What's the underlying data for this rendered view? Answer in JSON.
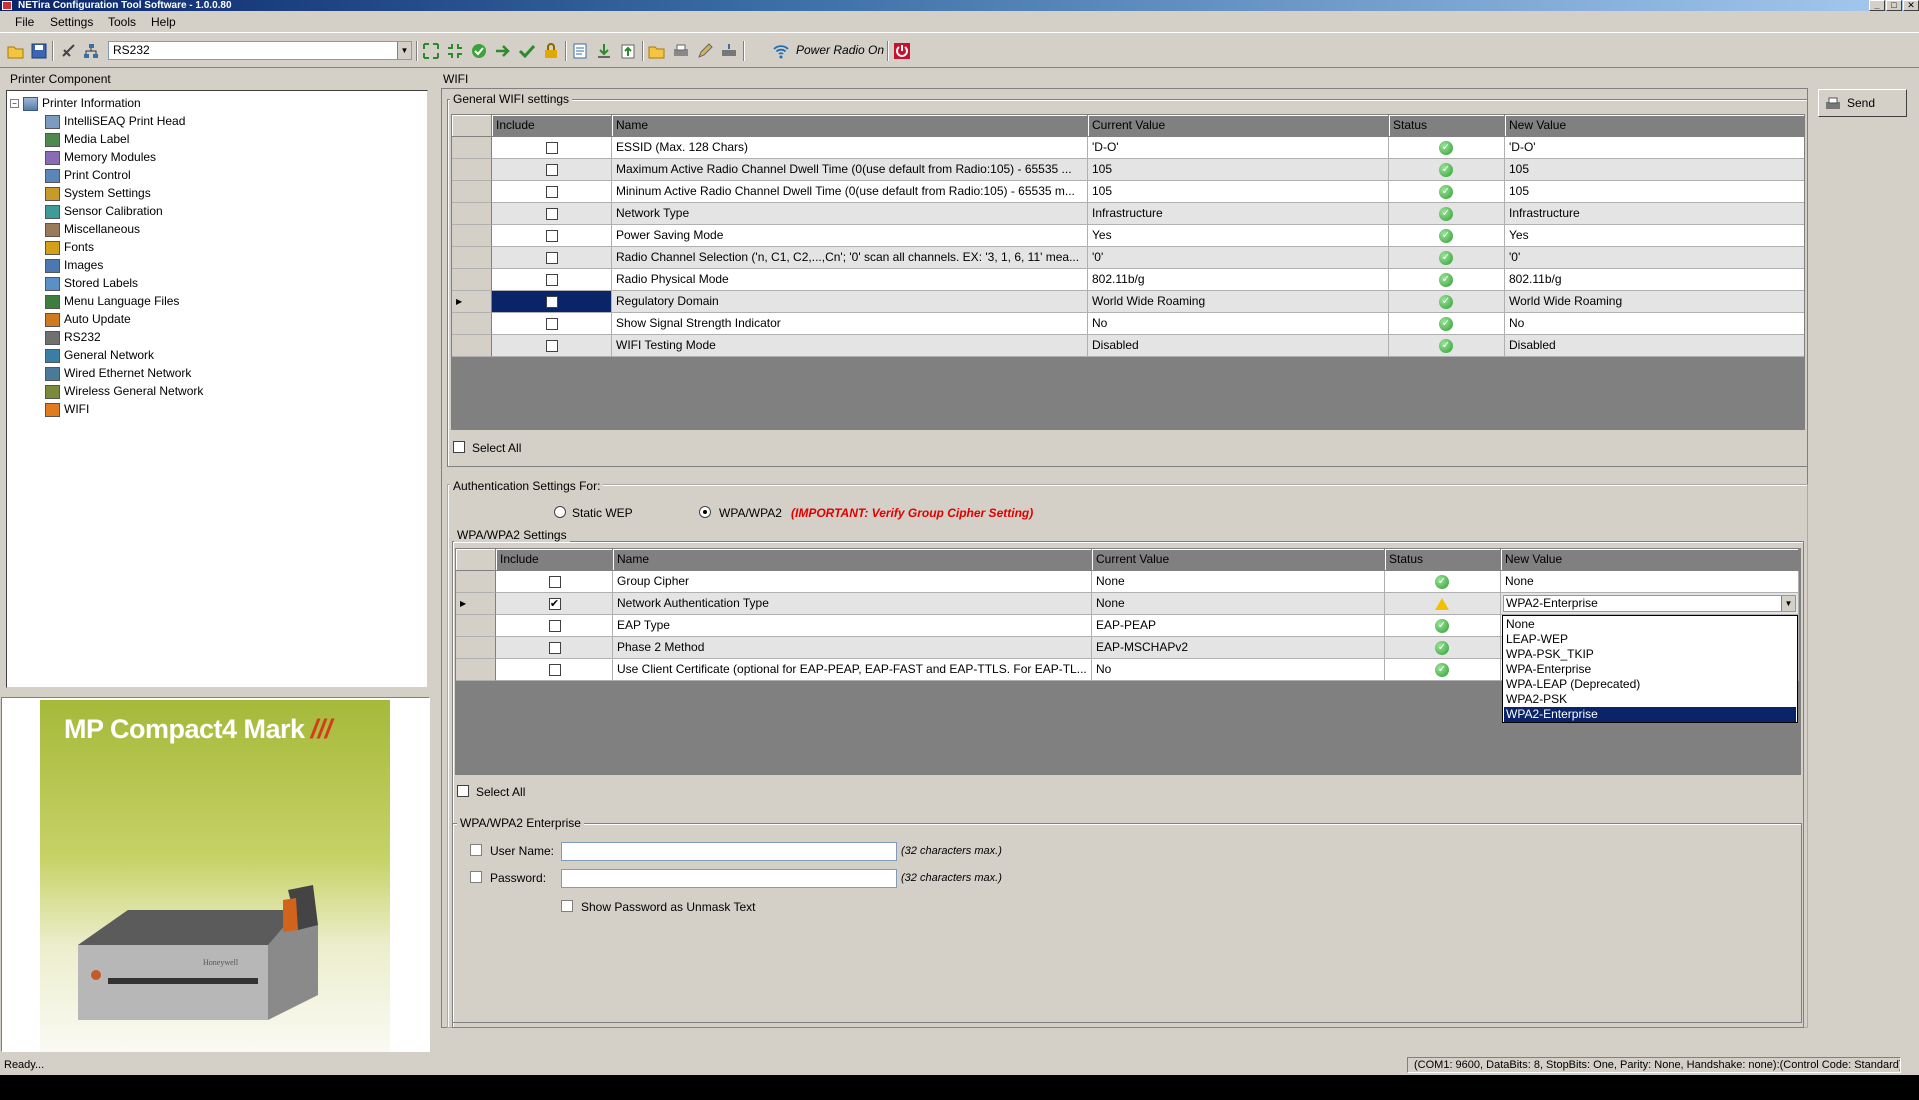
{
  "window": {
    "title": "NETira Configuration Tool Software - 1.0.0.80"
  },
  "menu": [
    "File",
    "Settings",
    "Tools",
    "Help"
  ],
  "toolbar": {
    "port_value": "RS232",
    "power_radio_label": "Power Radio On"
  },
  "left_panel": {
    "title": "Printer Component",
    "tree_root": "Printer Information",
    "tree_items": [
      "IntelliSEAQ Print Head",
      "Media Label",
      "Memory Modules",
      "Print Control",
      "System Settings",
      "Sensor Calibration",
      "Miscellaneous",
      "Fonts",
      "Images",
      "Stored Labels",
      "Menu Language Files",
      "Auto Update",
      "RS232",
      "General Network",
      "Wired Ethernet Network",
      "Wireless General Network",
      "WIFI"
    ],
    "tree_icons": [
      "printhead-icon",
      "label-icon",
      "memory-icon",
      "print-control-icon",
      "wrench-icon",
      "sensor-icon",
      "misc-icon",
      "font-icon",
      "images-icon",
      "stored-labels-icon",
      "language-icon",
      "auto-update-icon",
      "rs232-icon",
      "network-icon",
      "ethernet-icon",
      "wireless-icon",
      "wifi-icon"
    ],
    "product_banner": {
      "text": "MP Compact4 Mark",
      "mark": "///",
      "brand_on_printer": "Honeywell"
    }
  },
  "main": {
    "section_title": "WIFI",
    "send_button": "Send",
    "general": {
      "group_label": "General WIFI settings",
      "columns": [
        "Include",
        "Name",
        "Current Value",
        "Status",
        "New Value"
      ],
      "rows": [
        {
          "name": "ESSID (Max. 128 Chars)",
          "current": "'D-O'",
          "new": "'D-O'"
        },
        {
          "name": "Maximum Active Radio Channel Dwell Time (0(use default from Radio:105) - 65535 ...",
          "current": "105",
          "new": "105"
        },
        {
          "name": "Mininum Active Radio Channel Dwell Time (0(use default from Radio:105) - 65535 m...",
          "current": "105",
          "new": "105"
        },
        {
          "name": "Network Type",
          "current": "Infrastructure",
          "new": "Infrastructure"
        },
        {
          "name": "Power Saving Mode",
          "current": "Yes",
          "new": "Yes"
        },
        {
          "name": "Radio Channel Selection ('n, C1, C2,...,Cn'; '0' scan all channels. EX: '3, 1, 6, 11' mea...",
          "current": "'0'",
          "new": "'0'"
        },
        {
          "name": "Radio Physical Mode",
          "current": "802.11b/g",
          "new": "802.11b/g"
        },
        {
          "name": "Regulatory Domain",
          "current": "World Wide Roaming",
          "new": "World Wide Roaming"
        },
        {
          "name": "Show Signal Strength Indicator",
          "current": "No",
          "new": "No"
        },
        {
          "name": "WIFI Testing Mode",
          "current": "Disabled",
          "new": "Disabled"
        }
      ],
      "select_all": "Select All"
    },
    "auth": {
      "label": "Authentication Settings For:",
      "opt_static": "Static WEP",
      "opt_wpa": "WPA/WPA2",
      "important": "(IMPORTANT: Verify Group Cipher Setting)"
    },
    "wpa": {
      "group_label": "WPA/WPA2 Settings",
      "columns": [
        "Include",
        "Name",
        "Current Value",
        "Status",
        "New Value"
      ],
      "rows": [
        {
          "name": "Group Cipher",
          "current": "None",
          "new": "None",
          "checked": false,
          "status": "ok"
        },
        {
          "name": "Network Authentication Type",
          "current": "None",
          "new": "WPA2-Enterprise",
          "checked": true,
          "status": "warning"
        },
        {
          "name": "EAP Type",
          "current": "EAP-PEAP",
          "new": "",
          "checked": false,
          "status": "ok"
        },
        {
          "name": "Phase 2 Method",
          "current": "EAP-MSCHAPv2",
          "new": "",
          "checked": false,
          "status": "ok"
        },
        {
          "name": "Use Client Certificate (optional for EAP-PEAP, EAP-FAST and EAP-TTLS.  For EAP-TL...",
          "current": "No",
          "new": "",
          "checked": false,
          "status": "ok"
        }
      ],
      "dropdown_options": [
        "None",
        "LEAP-WEP",
        "WPA-PSK_TKIP",
        "WPA-Enterprise",
        "WPA-LEAP (Deprecated)",
        "WPA2-PSK",
        "WPA2-Enterprise"
      ],
      "dropdown_selected": "WPA2-Enterprise",
      "select_all": "Select All"
    },
    "enterprise": {
      "group_label": "WPA/WPA2 Enterprise",
      "username_label": "User Name:",
      "password_label": "Password:",
      "max_hint": "(32 characters max.)",
      "show_password": "Show Password as Unmask Text"
    }
  },
  "status": {
    "left": "Ready...",
    "right": "(COM1: 9600, DataBits: 8, StopBits: One, Parity: None, Handshake: none):(Control Code: Standard)"
  },
  "colors": {
    "selection": "#0a246a",
    "important": "#e00000",
    "ok": "#2f9e2f",
    "warning": "#f2c200"
  }
}
